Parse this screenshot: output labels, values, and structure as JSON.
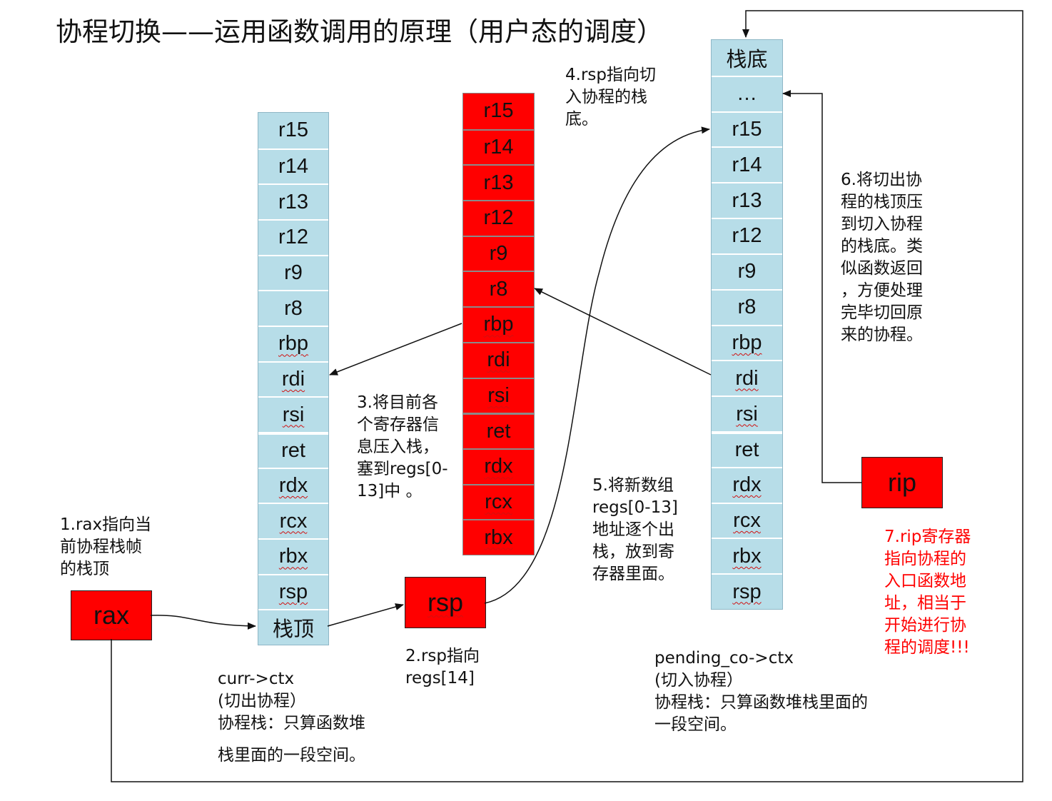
{
  "title": "协程切换——运用函数调用的原理（用户态的调度）",
  "stacks": {
    "left": {
      "cells": [
        "r15",
        "r14",
        "r13",
        "r12",
        "r9",
        "r8",
        "rbp",
        "rdi",
        "rsi",
        "ret",
        "rdx",
        "rcx",
        "rbx",
        "rsp",
        "栈顶"
      ]
    },
    "middle": {
      "cells": [
        "r15",
        "r14",
        "r13",
        "r12",
        "r9",
        "r8",
        "rbp",
        "rdi",
        "rsi",
        "ret",
        "rdx",
        "rcx",
        "rbx"
      ]
    },
    "right": {
      "cells": [
        "栈底",
        "…",
        "r15",
        "r14",
        "r13",
        "r12",
        "r9",
        "r8",
        "rbp",
        "rdi",
        "rsi",
        "ret",
        "rdx",
        "rcx",
        "rbx",
        "rsp"
      ]
    }
  },
  "boxes": {
    "rax": "rax",
    "rsp": "rsp",
    "rip": "rip"
  },
  "notes": {
    "n1": "1.rax指向当\n前协程栈帧\n的栈顶",
    "n2": "2.rsp指向\nregs[14]",
    "n3": "3.将目前各\n个寄存器信\n息压入栈，\n塞到regs[0-\n13]中 。",
    "n4": "4.rsp指向切\n入协程的栈\n底。",
    "n5": "5.将新数组\nregs[0-13]\n地址逐个出\n栈，放到寄\n存器里面。",
    "n6": "6.将切出协\n程的栈顶压\n到切入协程\n的栈底。类\n似函数返回\n，方便处理\n完毕切回原\n来的协程。",
    "n7": "7.rip寄存器\n指向协程的\n入口函数地\n址，相当于\n开始进行协\n程的调度!!!",
    "curr_label": "curr->ctx\n(切出协程）\n协程栈：只算函数堆",
    "curr_label2": "栈里面的一段空间。",
    "pending_label": "pending_co->ctx\n(切入协程）\n协程栈：只算函数堆栈里面的\n一段空间。"
  },
  "colors": {
    "stack_blue": "#b7dde8",
    "stack_red": "#ff0000",
    "note_red": "#ff0000"
  }
}
